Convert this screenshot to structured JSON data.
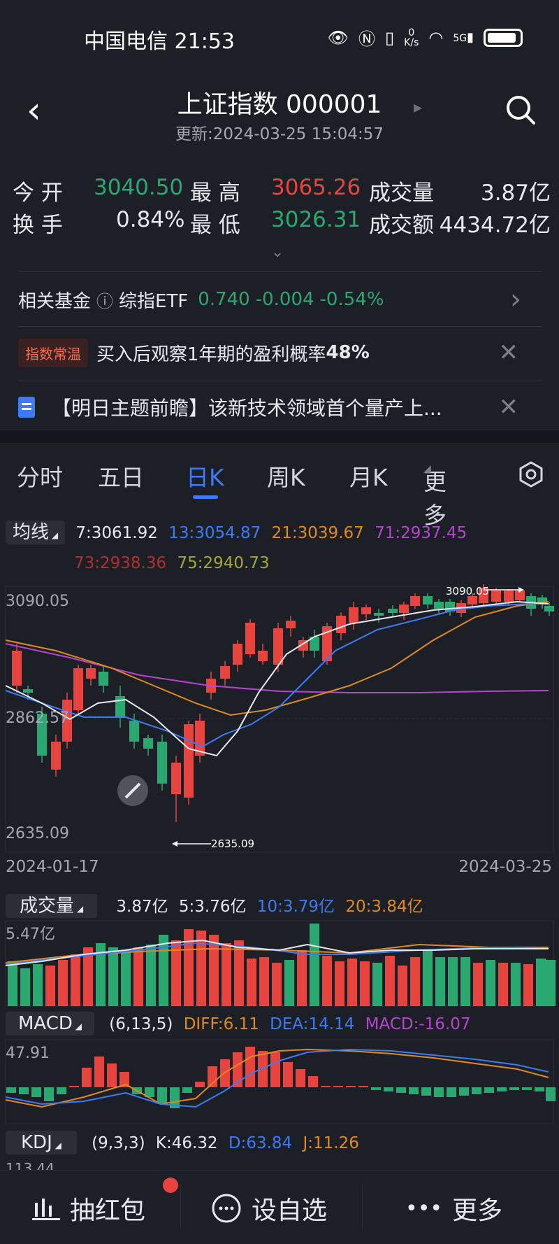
{
  "status_bar": {
    "carrier_time": "中国电信 21:53",
    "net_speed_top": "0",
    "net_speed_unit": "K/s",
    "signal": "5G"
  },
  "header": {
    "title": "上证指数 000001",
    "updated": "更新:2024-03-25 15:04:57"
  },
  "stats": {
    "open_label": "今 开",
    "open_value": "3040.50",
    "high_label": "最 高",
    "high_value": "3065.26",
    "volume_label": "成交量",
    "volume_value": "3.87亿",
    "turnover_label": "换 手",
    "turnover_value": "0.84%",
    "low_label": "最 低",
    "low_value": "3026.31",
    "amount_label": "成交额",
    "amount_value": "4434.72亿"
  },
  "fund_row": {
    "label": "相关基金",
    "name": "综指ETF",
    "price": "0.740",
    "change": "-0.004",
    "pct": "-0.54%"
  },
  "tip_row": {
    "badge": "指数常温",
    "text": "买入后观察1年期的盈利概率",
    "highlight": "48%"
  },
  "news_row": {
    "text": "【明日主题前瞻】该新技术领域首个量产上..."
  },
  "tabs": [
    "分时",
    "五日",
    "日K",
    "周K",
    "月K",
    "更多"
  ],
  "active_tab": "日K",
  "ma_legend": {
    "button": "均线",
    "ma7": "7:3061.92",
    "ma13": "13:3054.87",
    "ma21": "21:3039.67",
    "ma71": "71:2937.45",
    "ma73": "73:2938.36",
    "ma75": "75:2940.73"
  },
  "kline": {
    "y_top": "3090.05",
    "y_mid": "2862.57",
    "y_bottom": "2635.09",
    "max_label": "3090.05",
    "min_label": "2635.09",
    "date_start": "2024-01-17",
    "date_end": "2024-03-25"
  },
  "volume_legend": {
    "button": "成交量",
    "current": "3.87亿",
    "ma5": "5:3.76亿",
    "ma10": "10:3.79亿",
    "ma20": "20:3.84亿",
    "y_top": "5.47亿"
  },
  "macd_legend": {
    "button": "MACD",
    "params": "(6,13,5)",
    "diff": "DIFF:6.11",
    "dea": "DEA:14.14",
    "macd": "MACD:-16.07",
    "y_top": "47.91"
  },
  "kdj_legend": {
    "button": "KDJ",
    "params": "(9,3,3)",
    "k": "K:46.32",
    "d": "D:63.84",
    "j": "J:11.26",
    "y_top": "113.44"
  },
  "bottom_bar": {
    "red_packet": "抽红包",
    "add_watch": "设自选",
    "more": "更多"
  },
  "colors": {
    "up": "#e8443f",
    "down": "#2aa871",
    "accent": "#3d7bf5",
    "bg": "#1d1f27"
  },
  "chart_data": {
    "type": "candlestick",
    "x": [
      "2024-01-17",
      "2024-03-25"
    ],
    "ylim": [
      2635.09,
      3090.05
    ],
    "max": 3090.05,
    "min": 2635.09,
    "last_close_approx": 3026.31
  }
}
